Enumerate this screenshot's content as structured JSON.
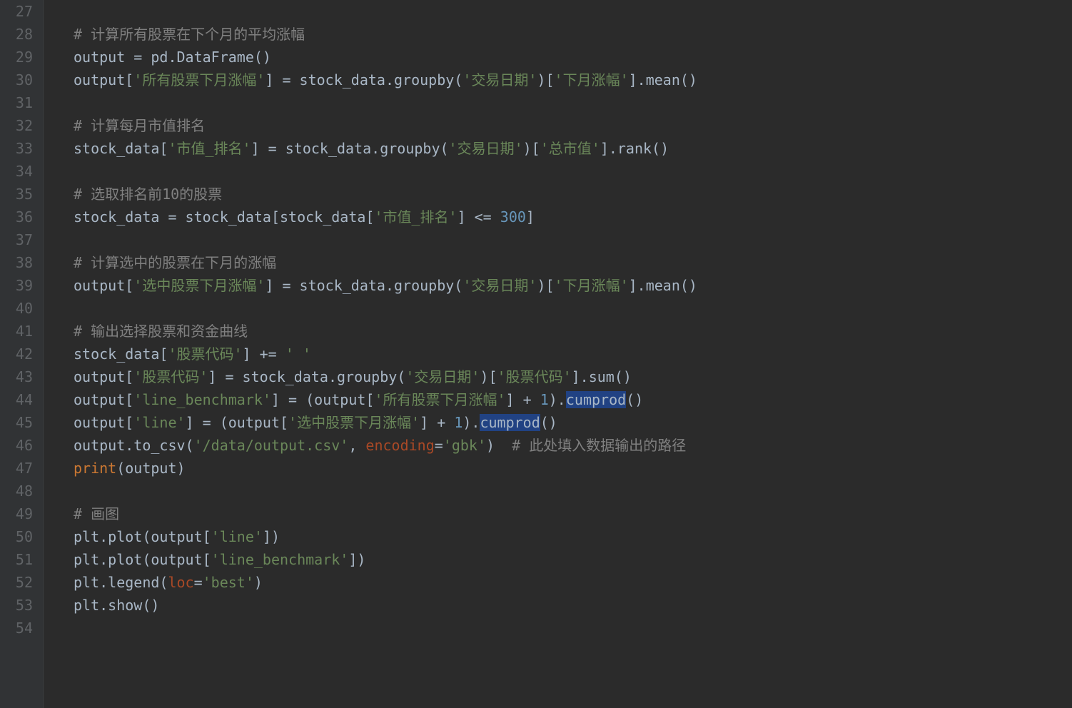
{
  "lines": [
    {
      "n": 27,
      "t": [
        {
          "c": "t-def",
          "v": ""
        }
      ]
    },
    {
      "n": 28,
      "t": [
        {
          "c": "t-cmt",
          "v": "# 计算所有股票在下个月的平均涨幅"
        }
      ]
    },
    {
      "n": 29,
      "t": [
        {
          "c": "t-def",
          "v": "output = pd.DataFrame()"
        }
      ]
    },
    {
      "n": 30,
      "t": [
        {
          "c": "t-def",
          "v": "output["
        },
        {
          "c": "t-str",
          "v": "'所有股票下月涨幅'"
        },
        {
          "c": "t-def",
          "v": "] = stock_data.groupby("
        },
        {
          "c": "t-str",
          "v": "'交易日期'"
        },
        {
          "c": "t-def",
          "v": ")["
        },
        {
          "c": "t-str",
          "v": "'下月涨幅'"
        },
        {
          "c": "t-def",
          "v": "].mean()"
        }
      ]
    },
    {
      "n": 31,
      "t": [
        {
          "c": "t-def",
          "v": ""
        }
      ]
    },
    {
      "n": 32,
      "t": [
        {
          "c": "t-cmt",
          "v": "# 计算每月市值排名"
        }
      ]
    },
    {
      "n": 33,
      "t": [
        {
          "c": "t-def",
          "v": "stock_data["
        },
        {
          "c": "t-str",
          "v": "'市值_排名'"
        },
        {
          "c": "t-def",
          "v": "] = stock_data.groupby("
        },
        {
          "c": "t-str",
          "v": "'交易日期'"
        },
        {
          "c": "t-def",
          "v": ")["
        },
        {
          "c": "t-str",
          "v": "'总市值'"
        },
        {
          "c": "t-def",
          "v": "].rank()"
        }
      ]
    },
    {
      "n": 34,
      "t": [
        {
          "c": "t-def",
          "v": ""
        }
      ]
    },
    {
      "n": 35,
      "t": [
        {
          "c": "t-cmt",
          "v": "# 选取排名前10的股票"
        }
      ]
    },
    {
      "n": 36,
      "t": [
        {
          "c": "t-def",
          "v": "stock_data = stock_data[stock_data["
        },
        {
          "c": "t-str",
          "v": "'市值_排名'"
        },
        {
          "c": "t-def",
          "v": "] <= "
        },
        {
          "c": "t-num",
          "v": "300"
        },
        {
          "c": "t-def",
          "v": "]"
        }
      ]
    },
    {
      "n": 37,
      "t": [
        {
          "c": "t-def",
          "v": ""
        }
      ]
    },
    {
      "n": 38,
      "t": [
        {
          "c": "t-cmt",
          "v": "# 计算选中的股票在下月的涨幅"
        }
      ]
    },
    {
      "n": 39,
      "t": [
        {
          "c": "t-def",
          "v": "output["
        },
        {
          "c": "t-str",
          "v": "'选中股票下月涨幅'"
        },
        {
          "c": "t-def",
          "v": "] = stock_data.groupby("
        },
        {
          "c": "t-str",
          "v": "'交易日期'"
        },
        {
          "c": "t-def",
          "v": ")["
        },
        {
          "c": "t-str",
          "v": "'下月涨幅'"
        },
        {
          "c": "t-def",
          "v": "].mean()"
        }
      ]
    },
    {
      "n": 40,
      "t": [
        {
          "c": "t-def",
          "v": ""
        }
      ]
    },
    {
      "n": 41,
      "t": [
        {
          "c": "t-cmt",
          "v": "# 输出选择股票和资金曲线"
        }
      ]
    },
    {
      "n": 42,
      "t": [
        {
          "c": "t-def",
          "v": "stock_data["
        },
        {
          "c": "t-str",
          "v": "'股票代码'"
        },
        {
          "c": "t-def",
          "v": "] += "
        },
        {
          "c": "t-str",
          "v": "' '"
        }
      ]
    },
    {
      "n": 43,
      "t": [
        {
          "c": "t-def",
          "v": "output["
        },
        {
          "c": "t-str",
          "v": "'股票代码'"
        },
        {
          "c": "t-def",
          "v": "] = stock_data.groupby("
        },
        {
          "c": "t-str",
          "v": "'交易日期'"
        },
        {
          "c": "t-def",
          "v": ")["
        },
        {
          "c": "t-str",
          "v": "'股票代码'"
        },
        {
          "c": "t-def",
          "v": "].sum()"
        }
      ]
    },
    {
      "n": 44,
      "t": [
        {
          "c": "t-def",
          "v": "output["
        },
        {
          "c": "t-str",
          "v": "'line_benchmark'"
        },
        {
          "c": "t-def",
          "v": "] = (output["
        },
        {
          "c": "t-str",
          "v": "'所有股票下月涨幅'"
        },
        {
          "c": "t-def",
          "v": "] + "
        },
        {
          "c": "t-num",
          "v": "1"
        },
        {
          "c": "t-def",
          "v": ")."
        },
        {
          "c": "hl",
          "v": "cumprod"
        },
        {
          "c": "t-def",
          "v": "()"
        }
      ]
    },
    {
      "n": 45,
      "t": [
        {
          "c": "t-def",
          "v": "output["
        },
        {
          "c": "t-str",
          "v": "'line'"
        },
        {
          "c": "t-def",
          "v": "] = (output["
        },
        {
          "c": "t-str",
          "v": "'选中股票下月涨幅'"
        },
        {
          "c": "t-def",
          "v": "] + "
        },
        {
          "c": "t-num",
          "v": "1"
        },
        {
          "c": "t-def",
          "v": ")."
        },
        {
          "c": "hl",
          "v": "cumprod"
        },
        {
          "c": "t-def",
          "v": "()"
        }
      ]
    },
    {
      "n": 46,
      "t": [
        {
          "c": "t-def",
          "v": "output.to_csv("
        },
        {
          "c": "t-str",
          "v": "'/data/output.csv'"
        },
        {
          "c": "t-def",
          "v": ", "
        },
        {
          "c": "t-kwarg",
          "v": "encoding"
        },
        {
          "c": "t-def",
          "v": "="
        },
        {
          "c": "t-str",
          "v": "'gbk'"
        },
        {
          "c": "t-def",
          "v": ")  "
        },
        {
          "c": "t-cmt",
          "v": "# 此处填入数据输出的路径"
        }
      ]
    },
    {
      "n": 47,
      "t": [
        {
          "c": "t-kw",
          "v": "print"
        },
        {
          "c": "t-def",
          "v": "(output)"
        }
      ]
    },
    {
      "n": 48,
      "t": [
        {
          "c": "t-def",
          "v": ""
        }
      ]
    },
    {
      "n": 49,
      "t": [
        {
          "c": "t-cmt",
          "v": "# 画图"
        }
      ]
    },
    {
      "n": 50,
      "t": [
        {
          "c": "t-def",
          "v": "plt.plot(output["
        },
        {
          "c": "t-str",
          "v": "'line'"
        },
        {
          "c": "t-def",
          "v": "])"
        }
      ]
    },
    {
      "n": 51,
      "t": [
        {
          "c": "t-def",
          "v": "plt.plot(output["
        },
        {
          "c": "t-str",
          "v": "'line_benchmark'"
        },
        {
          "c": "t-def",
          "v": "])"
        }
      ]
    },
    {
      "n": 52,
      "t": [
        {
          "c": "t-def",
          "v": "plt.legend("
        },
        {
          "c": "t-kwarg",
          "v": "loc"
        },
        {
          "c": "t-def",
          "v": "="
        },
        {
          "c": "t-str",
          "v": "'best'"
        },
        {
          "c": "t-def",
          "v": ")"
        }
      ]
    },
    {
      "n": 53,
      "t": [
        {
          "c": "t-def",
          "v": "plt.show()"
        }
      ]
    },
    {
      "n": 54,
      "t": [
        {
          "c": "t-def",
          "v": ""
        }
      ]
    }
  ]
}
